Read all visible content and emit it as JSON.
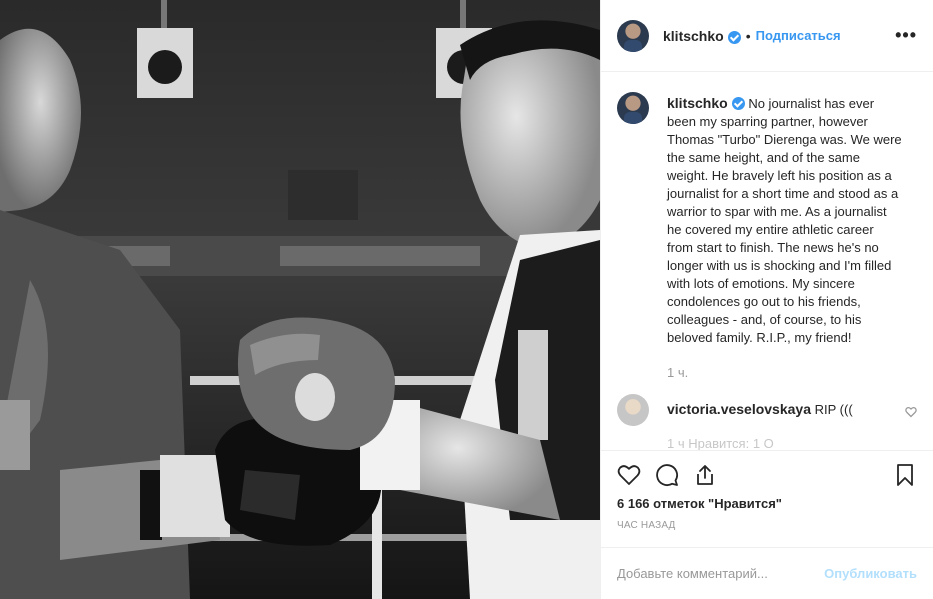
{
  "post": {
    "image_alt": "Black and white photo of two boxers touching gloves"
  },
  "header": {
    "username": "klitschko",
    "separator": "•",
    "follow_label": "Подписаться",
    "more_label": "•••"
  },
  "caption": {
    "username": "klitschko",
    "text": "No journalist has ever been my sparring partner, however Thomas \"Turbo\" Dierenga was. We were the same height, and of the same weight. He bravely left his position as a journalist for a short time and stood as a warrior to spar with me. As a journalist he covered my entire athletic career from start to finish. The news he's no longer with us is shocking and I'm filled with lots of emotions. My sincere condolences go out to his friends, colleagues - and, of course, to his beloved family. R.I.P., my friend!",
    "time": "1 ч."
  },
  "comments": [
    {
      "username": "victoria.veselovskaya",
      "text": "RIP ((("
    }
  ],
  "comment_partial": "1 ч  Нравится: 1  О",
  "likes": "6 166 отметок \"Нравится\"",
  "posted_time": "ЧАС НАЗАД",
  "add_comment": {
    "placeholder": "Добавьте комментарий...",
    "publish_label": "Опубликовать"
  },
  "icons": {
    "like": "heart-icon",
    "comment": "comment-bubble-icon",
    "share": "share-icon",
    "save": "bookmark-icon",
    "verified": "verified-badge-icon"
  },
  "colors": {
    "accent": "#3897f0",
    "muted": "#999999",
    "publish_disabled": "#b2dffc"
  }
}
